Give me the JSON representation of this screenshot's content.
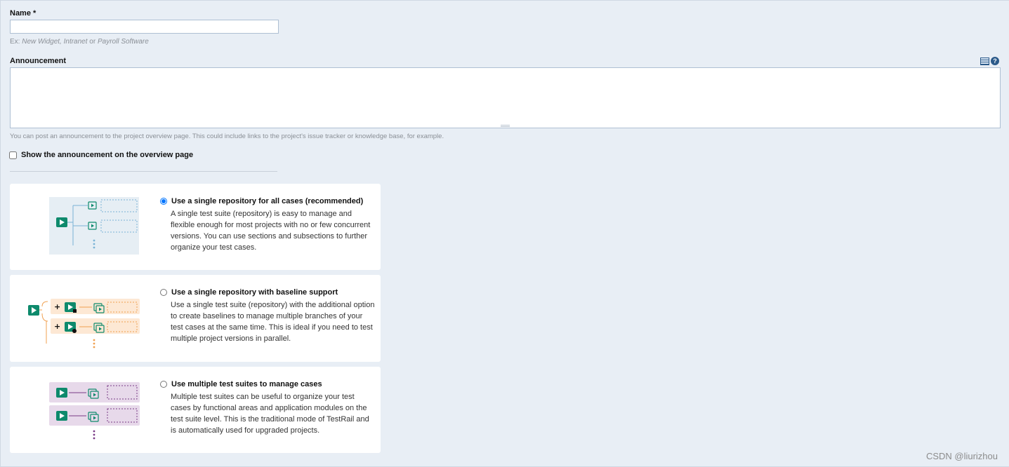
{
  "form": {
    "name_label": "Name *",
    "name_value": "",
    "name_hint_prefix": "Ex: ",
    "name_hint_examples": "New Widget, Intranet",
    "name_hint_or": " or ",
    "name_hint_last": "Payroll Software",
    "announcement_label": "Announcement",
    "announcement_value": "",
    "announcement_hint": "You can post an announcement to the project overview page. This could include links to the project's issue tracker or knowledge base, for example.",
    "show_announcement_label": "Show the announcement on the overview page",
    "show_announcement_checked": false
  },
  "toolbar": {
    "icons": [
      "table-icon",
      "help-icon"
    ],
    "help_glyph": "?"
  },
  "suite_modes": [
    {
      "title": "Use a single repository for all cases (recommended)",
      "description": "A single test suite (repository) is easy to manage and flexible enough for most projects with no or few concurrent versions. You can use sections and subsections to further organize your test cases.",
      "selected": true,
      "accent": "#7ab3d6",
      "tint": "#e6eef4"
    },
    {
      "title": "Use a single repository with baseline support",
      "description": "Use a single test suite (repository) with the additional option to create baselines to manage multiple branches of your test cases at the same time. This is ideal if you need to test multiple project versions in parallel.",
      "selected": false,
      "accent": "#f0a050",
      "tint": "#fde8d4"
    },
    {
      "title": "Use multiple test suites to manage cases",
      "description": "Multiple test suites can be useful to organize your test cases by functional areas and application modules on the test suite level. This is the traditional mode of TestRail and is automatically used for upgraded projects.",
      "selected": false,
      "accent": "#7a3a86",
      "tint": "#e7d9ea"
    }
  ],
  "colors": {
    "brand_green": "#0e8a6c",
    "background": "#e8eef5"
  },
  "watermark": "CSDN @liurizhou"
}
